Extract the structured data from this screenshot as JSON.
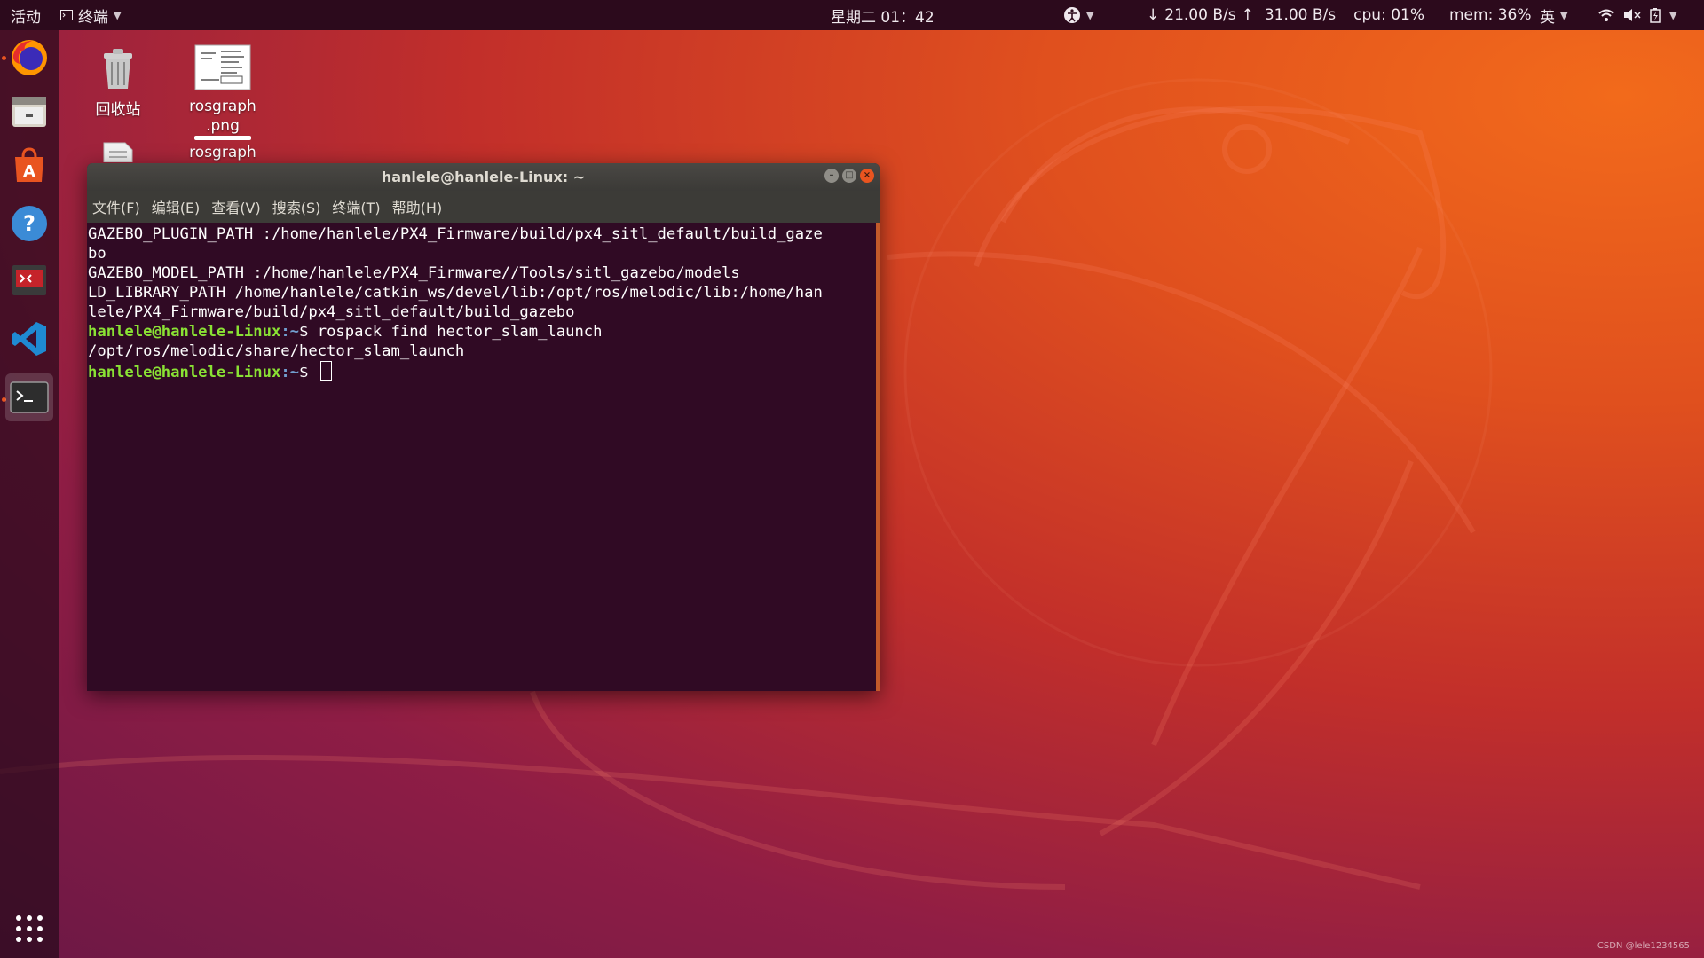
{
  "topbar": {
    "activities": "活动",
    "app_name": "终端",
    "clock": "星期二 01：42",
    "net_down": "21.00 B/s",
    "net_up": "31.00 B/s",
    "cpu": "cpu: 01%",
    "mem": "mem: 36%",
    "input_method": "英"
  },
  "desktop": {
    "icons": [
      {
        "label": "回收站",
        "icon": "trash-icon"
      },
      {
        "label": "rosgraph\n.png",
        "icon": "image-file-icon"
      },
      {
        "label": "rosgraph",
        "icon": "document-file-icon"
      }
    ]
  },
  "dock": {
    "items": [
      {
        "name": "firefox-icon"
      },
      {
        "name": "files-icon"
      },
      {
        "name": "software-center-icon"
      },
      {
        "name": "help-icon"
      },
      {
        "name": "presentation-app-icon"
      },
      {
        "name": "vscode-icon"
      },
      {
        "name": "terminal-icon"
      },
      {
        "name": "app-grid-icon"
      }
    ]
  },
  "terminal": {
    "title": "hanlele@hanlele-Linux: ~",
    "menu": [
      "文件(F)",
      "编辑(E)",
      "查看(V)",
      "搜索(S)",
      "终端(T)",
      "帮助(H)"
    ],
    "lines": [
      "GAZEBO_PLUGIN_PATH :/home/hanlele/PX4_Firmware/build/px4_sitl_default/build_gaze",
      "bo",
      "GAZEBO_MODEL_PATH :/home/hanlele/PX4_Firmware//Tools/sitl_gazebo/models",
      "LD_LIBRARY_PATH /home/hanlele/catkin_ws/devel/lib:/opt/ros/melodic/lib:/home/han",
      "lele/PX4_Firmware/build/px4_sitl_default/build_gazebo"
    ],
    "prompt_user": "hanlele@hanlele-Linux",
    "prompt_path": ":~",
    "prompt_sign": "$ ",
    "command": "rospack find hector_slam_launch",
    "output": "/opt/ros/melodic/share/hector_slam_launch"
  },
  "watermark": "CSDN @lele1234565",
  "colors": {
    "terminal_bg": "#300a24",
    "prompt_user": "#8ae234",
    "topbar_bg": "#2c0a1c",
    "accent": "#e95420"
  }
}
